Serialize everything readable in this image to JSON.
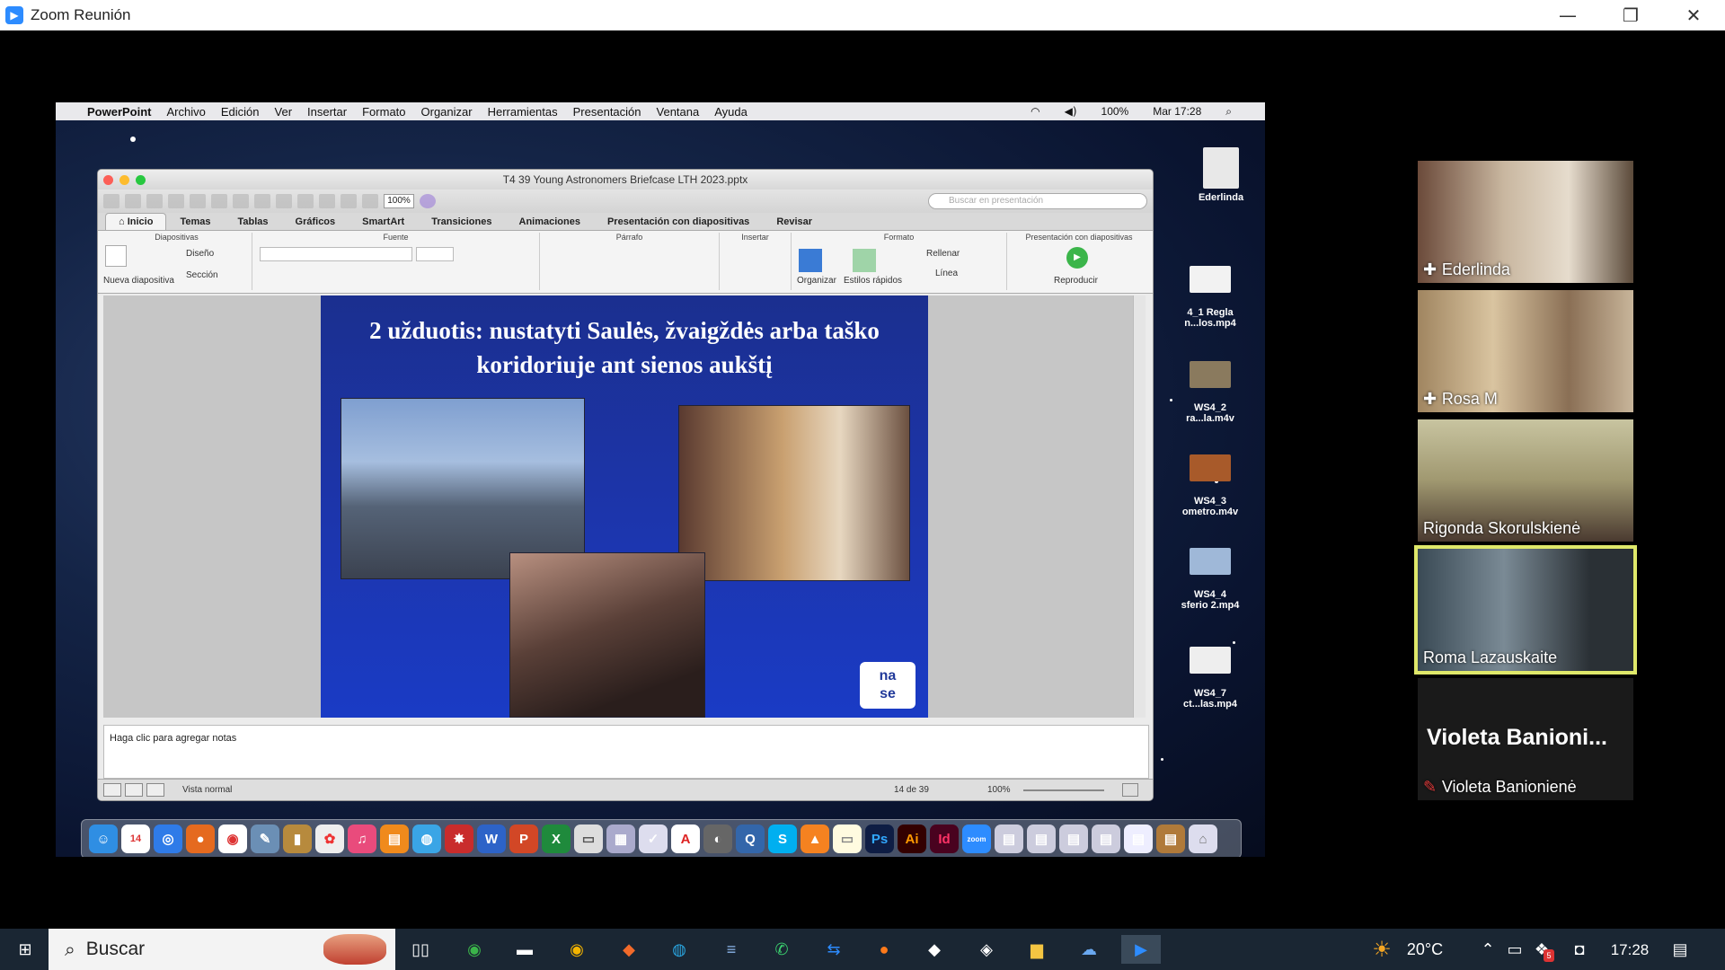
{
  "zoom": {
    "window_title": "Zoom Reunión",
    "controls": {
      "minimize": "—",
      "restore": "❐",
      "close": "✕"
    }
  },
  "mac_menubar": {
    "apple": "",
    "app": "PowerPoint",
    "items": [
      "Archivo",
      "Edición",
      "Ver",
      "Insertar",
      "Formato",
      "Organizar",
      "Herramientas",
      "Presentación",
      "Ventana",
      "Ayuda"
    ],
    "battery": "100%",
    "clock": "Mar 17:28"
  },
  "desktop_icons": [
    {
      "label": "Ederlinda"
    },
    {
      "label": "4_1 Regla\nn...los.mp4"
    },
    {
      "label": "WS4_2\nra...la.m4v"
    },
    {
      "label": "WS4_3\nometro.m4v"
    },
    {
      "label": "WS4_4\nsferio 2.mp4"
    },
    {
      "label": "WS4_7\nct...las.mp4"
    }
  ],
  "powerpoint": {
    "file_title": "T4 39 Young Astronomers Briefcase LTH 2023.pptx",
    "zoom_value": "100%",
    "search_placeholder": "Buscar en presentación",
    "tabs": [
      "Inicio",
      "Temas",
      "Tablas",
      "Gráficos",
      "SmartArt",
      "Transiciones",
      "Animaciones",
      "Presentación con diapositivas",
      "Revisar"
    ],
    "groups": {
      "diapositivas": "Diapositivas",
      "fuente": "Fuente",
      "parrafo": "Párrafo",
      "insertar": "Insertar",
      "formato": "Formato",
      "presentacion": "Presentación con diapositivas"
    },
    "buttons": {
      "nueva": "Nueva diapositiva",
      "diseno": "Diseño",
      "seccion": "Sección",
      "organizar": "Organizar",
      "estilos": "Estilos rápidos",
      "rellenar": "Rellenar",
      "linea": "Línea",
      "reproducir": "Reproducir"
    },
    "slide_title": "2 užduotis: nustatyti Saulės, žvaigždės arba taško koridoriuje ant sienos aukštį",
    "logo_text": "na\nse",
    "notes_placeholder": "Haga clic para agregar notas",
    "status_view": "Vista normal",
    "slide_counter": "14 de 39",
    "status_zoom": "100%"
  },
  "participants": [
    {
      "name": "Ederlinda",
      "pinned": true
    },
    {
      "name": "Rosa M",
      "pinned": true
    },
    {
      "name": "Rigonda Skorulskienė",
      "pinned": false
    },
    {
      "name": "Roma Lazauskaite",
      "pinned": false,
      "active": true
    },
    {
      "name": "Violeta  Banioni...",
      "subname": "Violeta Banionienė",
      "muted": true
    }
  ],
  "taskbar": {
    "search_placeholder": "Buscar",
    "weather": "20°C",
    "time": "17:28",
    "mail_badge": "5"
  },
  "colors": {
    "zoom_blue": "#2d8cff",
    "active_speaker": "#dfe86a",
    "slide_blue": "#1c36b0",
    "taskbar": "#1a2633"
  }
}
